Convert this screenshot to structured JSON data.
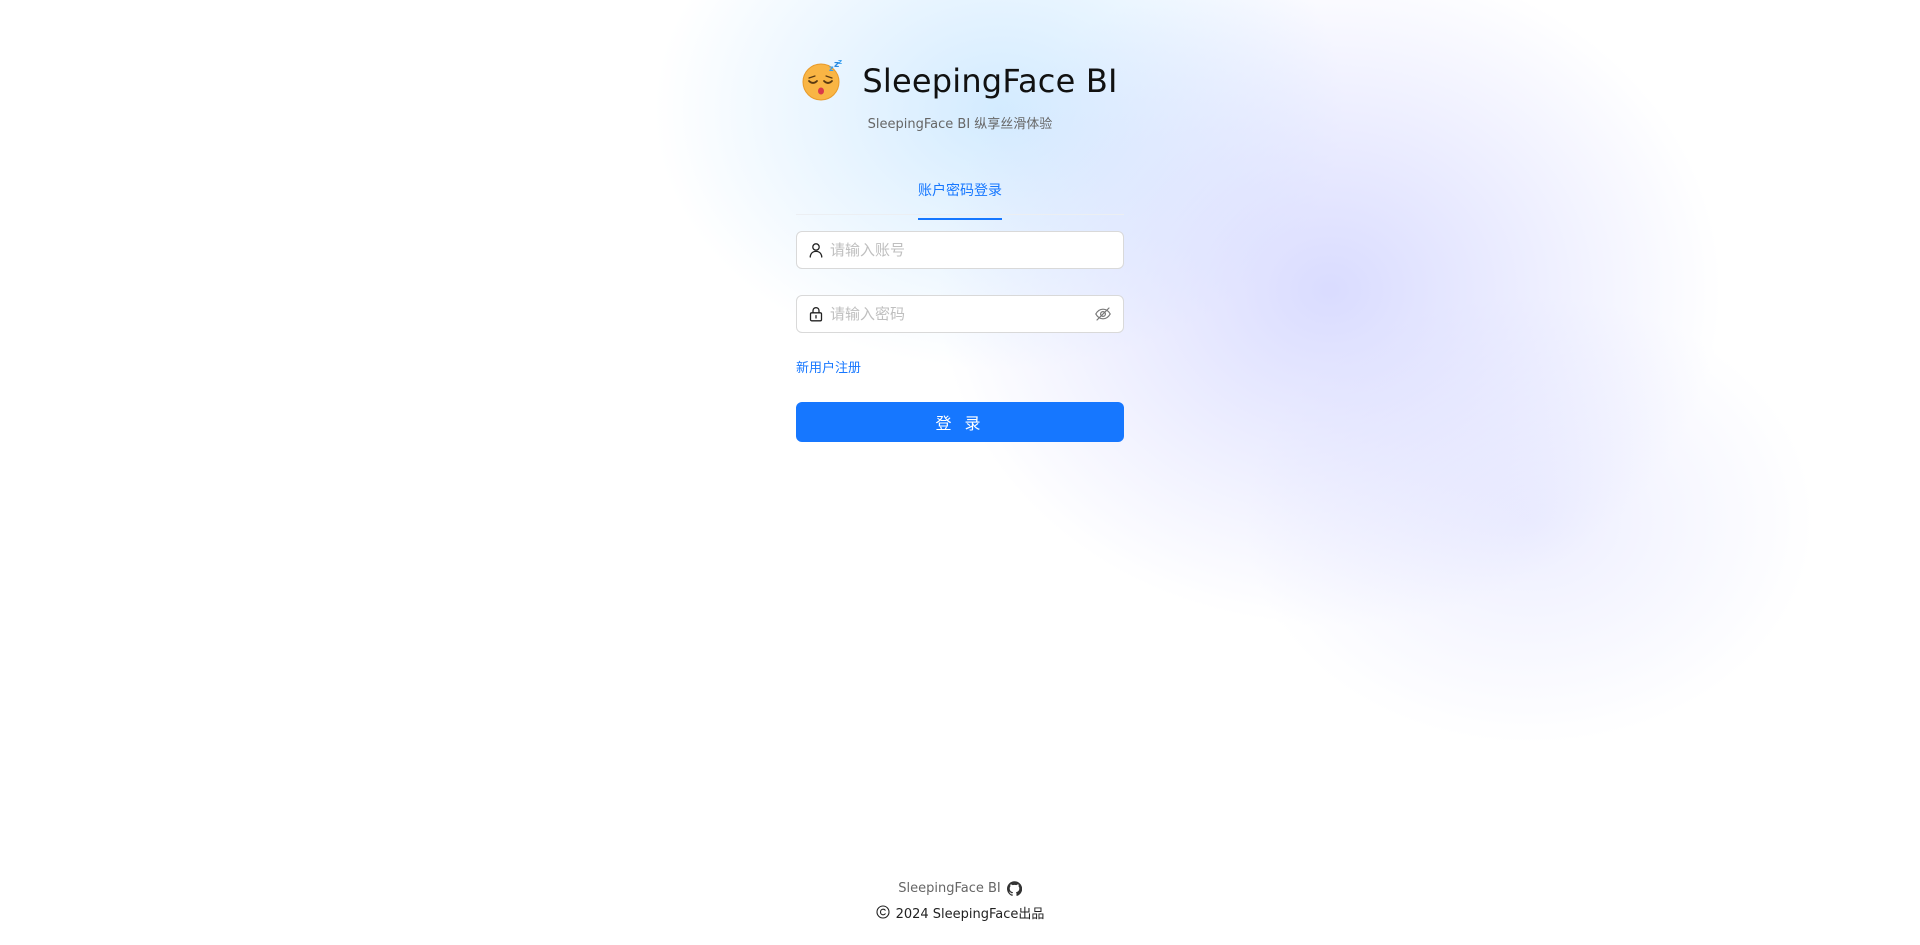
{
  "brand": {
    "title": "SleepingFace BI",
    "subtitle": "SleepingFace BI 纵享丝滑体验",
    "logo_icon": "sleeping-face-emoji-icon"
  },
  "login": {
    "tabs": [
      {
        "label": "账户密码登录",
        "active": true
      }
    ],
    "account_field": {
      "placeholder": "请输入账号",
      "value": "",
      "prefix_icon": "user-icon"
    },
    "password_field": {
      "placeholder": "请输入密码",
      "value": "",
      "prefix_icon": "lock-icon",
      "suffix_icon": "eye-invisible-icon"
    },
    "register_label": "新用户注册",
    "submit_label": "登 录"
  },
  "footer": {
    "brand_text": "SleepingFace BI",
    "github_icon": "github-icon",
    "copyright_text": "2024 SleepingFace出品"
  },
  "colors": {
    "accent": "#1677ff",
    "text_primary": "#111111",
    "text_secondary": "#666666",
    "placeholder": "#bfbfbf",
    "border": "#d9d9d9"
  }
}
